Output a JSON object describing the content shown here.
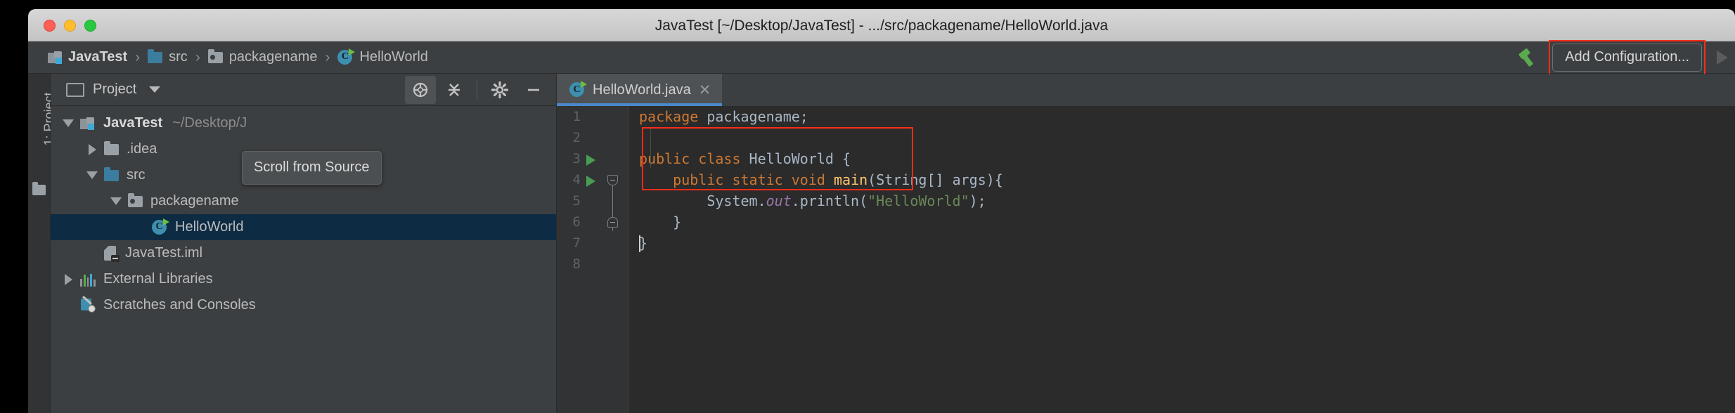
{
  "window": {
    "title": "JavaTest [~/Desktop/JavaTest] - .../src/packagename/HelloWorld.java",
    "close_label": "",
    "minimize_label": "",
    "zoom_label": ""
  },
  "breadcrumb": {
    "items": [
      {
        "label": "JavaTest",
        "icon": "module-icon"
      },
      {
        "label": "src",
        "icon": "folder-blue-icon"
      },
      {
        "label": "packagename",
        "icon": "package-icon"
      },
      {
        "label": "HelloWorld",
        "icon": "java-class-icon"
      }
    ],
    "separator": "›"
  },
  "toolbar_right": {
    "hammer_icon": "build-hammer-icon",
    "add_configuration_label": "Add Configuration...",
    "run_icon": "run-play-icon",
    "highlight_color": "#ff2d18"
  },
  "project_panel": {
    "stripe_label": "1: Project",
    "title": "Project",
    "dropdown_icon": "chevron-down-icon",
    "tools": [
      {
        "name": "scroll-from-source-icon",
        "active": true
      },
      {
        "name": "collapse-all-icon",
        "active": false
      },
      {
        "name": "gear-icon",
        "active": false
      },
      {
        "name": "hide-icon",
        "active": false
      }
    ],
    "tooltip": "Scroll from Source",
    "tree": [
      {
        "label": "JavaTest",
        "detail": "~/Desktop/J",
        "icon": "module-icon",
        "twisty": "down",
        "indent": 0,
        "bold": true,
        "selected": false
      },
      {
        "label": ".idea",
        "detail": "",
        "icon": "folder-gray-icon",
        "twisty": "right",
        "indent": 1,
        "bold": false,
        "selected": false
      },
      {
        "label": "src",
        "detail": "",
        "icon": "folder-blue-icon",
        "twisty": "down",
        "indent": 1,
        "bold": false,
        "selected": false
      },
      {
        "label": "packagename",
        "detail": "",
        "icon": "package-icon",
        "twisty": "down",
        "indent": 2,
        "bold": false,
        "selected": false
      },
      {
        "label": "HelloWorld",
        "detail": "",
        "icon": "java-class-icon",
        "twisty": "none",
        "indent": 3,
        "bold": false,
        "selected": true
      },
      {
        "label": "JavaTest.iml",
        "detail": "",
        "icon": "iml-file-icon",
        "twisty": "none",
        "indent": 1,
        "bold": false,
        "selected": false
      },
      {
        "label": "External Libraries",
        "detail": "",
        "icon": "libraries-icon",
        "twisty": "right",
        "indent": 0,
        "bold": false,
        "selected": false
      },
      {
        "label": "Scratches and Consoles",
        "detail": "",
        "icon": "scratches-icon",
        "twisty": "none",
        "indent": 0,
        "bold": false,
        "selected": false
      }
    ]
  },
  "editor": {
    "tab": {
      "filename": "HelloWorld.java",
      "icon": "java-class-icon",
      "close_icon": "close-icon",
      "active_underline_color": "#4a88c7"
    },
    "gutter_lines": [
      "1",
      "2",
      "3",
      "4",
      "5",
      "6",
      "7",
      "8"
    ],
    "run_markers": [
      3,
      4
    ],
    "fold_markers": [
      4,
      6
    ],
    "highlight_color": "#ff2d18",
    "code_lines": [
      {
        "number": 1,
        "tokens": [
          {
            "t": "package",
            "c": "kw"
          },
          {
            "t": " ",
            "c": "pln"
          },
          {
            "t": "packagename;",
            "c": "pln"
          }
        ]
      },
      {
        "number": 2,
        "tokens": []
      },
      {
        "number": 3,
        "tokens": [
          {
            "t": "public",
            "c": "kw"
          },
          {
            "t": " ",
            "c": "pln"
          },
          {
            "t": "class",
            "c": "kw"
          },
          {
            "t": " HelloWorld {",
            "c": "pln"
          }
        ]
      },
      {
        "number": 4,
        "tokens": [
          {
            "t": "    ",
            "c": "pln"
          },
          {
            "t": "public",
            "c": "kw"
          },
          {
            "t": " ",
            "c": "pln"
          },
          {
            "t": "static",
            "c": "kw"
          },
          {
            "t": " ",
            "c": "pln"
          },
          {
            "t": "void",
            "c": "kw"
          },
          {
            "t": " ",
            "c": "pln"
          },
          {
            "t": "main",
            "c": "mth"
          },
          {
            "t": "(String[] args){",
            "c": "pln"
          }
        ]
      },
      {
        "number": 5,
        "tokens": [
          {
            "t": "        System.",
            "c": "pln"
          },
          {
            "t": "out",
            "c": "fld"
          },
          {
            "t": ".println(",
            "c": "pln"
          },
          {
            "t": "\"HelloWorld\"",
            "c": "str"
          },
          {
            "t": ");",
            "c": "pln"
          }
        ]
      },
      {
        "number": 6,
        "tokens": [
          {
            "t": "    }",
            "c": "pln"
          }
        ]
      },
      {
        "number": 7,
        "tokens": [
          {
            "t": "}",
            "c": "pln"
          }
        ]
      },
      {
        "number": 8,
        "tokens": []
      }
    ]
  }
}
